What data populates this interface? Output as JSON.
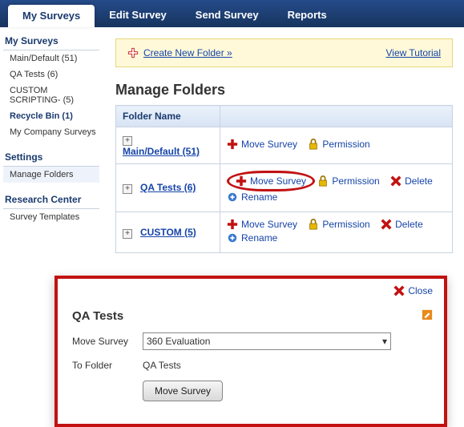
{
  "tabs": {
    "my_surveys": "My Surveys",
    "edit_survey": "Edit Survey",
    "send_survey": "Send Survey",
    "reports": "Reports"
  },
  "sidebar": {
    "groups": [
      {
        "title": "My Surveys",
        "items": [
          {
            "label": "Main/Default (51)"
          },
          {
            "label": "QA Tests (6)"
          },
          {
            "label": "CUSTOM SCRIPTING- (5)"
          },
          {
            "label": "Recycle Bin (1)",
            "bold": true
          },
          {
            "label": "My Company Surveys"
          }
        ]
      },
      {
        "title": "Settings",
        "items": [
          {
            "label": "Manage Folders",
            "selected": true
          }
        ]
      },
      {
        "title": "Research Center",
        "items": [
          {
            "label": "Survey Templates"
          }
        ]
      }
    ]
  },
  "create_bar": {
    "create_label": "Create New Folder »",
    "tutorial_label": "View Tutorial"
  },
  "page_title": "Manage Folders",
  "table": {
    "header": "Folder Name",
    "rows": [
      {
        "expand": "+",
        "label": "Main/Default (51)",
        "actions": {
          "move": "Move Survey",
          "perm": "Permission"
        }
      },
      {
        "expand": "+",
        "label": "QA Tests (6)",
        "actions": {
          "move": "Move Survey",
          "perm": "Permission",
          "del": "Delete",
          "ren": "Rename"
        }
      },
      {
        "expand": "+",
        "label": "CUSTOM (5)",
        "actions": {
          "move": "Move Survey",
          "perm": "Permission",
          "del": "Delete",
          "ren": "Rename"
        }
      }
    ]
  },
  "modal": {
    "close_label": "Close",
    "title": "QA Tests",
    "move_label": "Move Survey",
    "move_value": "360 Evaluation",
    "tofolder_label": "To Folder",
    "tofolder_value": "QA Tests",
    "button_label": "Move Survey"
  }
}
